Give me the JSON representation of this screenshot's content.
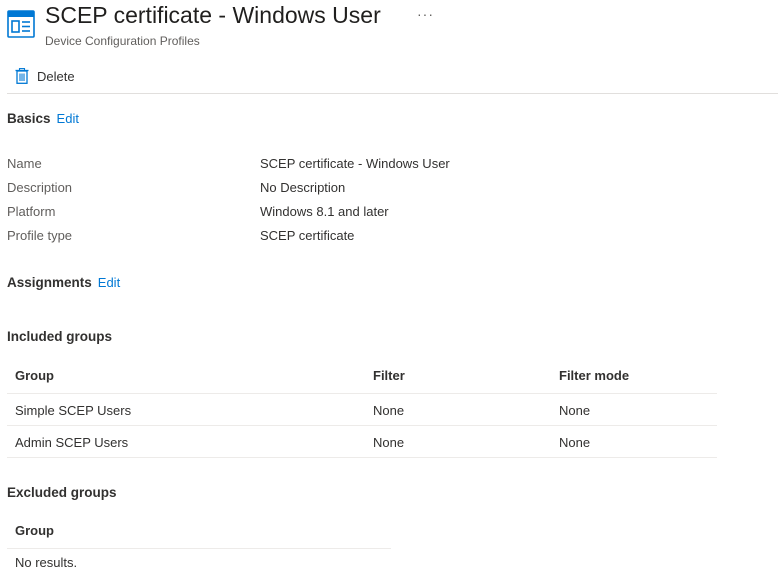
{
  "header": {
    "title": "SCEP certificate - Windows User",
    "more_label": "···",
    "subtitle": "Device Configuration Profiles",
    "icon": "profile-window-icon"
  },
  "toolbar": {
    "delete_label": "Delete",
    "delete_icon": "trash-icon"
  },
  "basics": {
    "title": "Basics",
    "edit_label": "Edit",
    "properties": [
      {
        "label": "Name",
        "value": "SCEP certificate - Windows User"
      },
      {
        "label": "Description",
        "value": "No Description"
      },
      {
        "label": "Platform",
        "value": "Windows 8.1 and later"
      },
      {
        "label": "Profile type",
        "value": "SCEP certificate"
      }
    ]
  },
  "assignments": {
    "title": "Assignments",
    "edit_label": "Edit",
    "included": {
      "title": "Included groups",
      "columns": [
        "Group",
        "Filter",
        "Filter mode"
      ],
      "rows": [
        [
          "Simple SCEP Users",
          "None",
          "None"
        ],
        [
          "Admin SCEP Users",
          "None",
          "None"
        ]
      ]
    },
    "excluded": {
      "title": "Excluded groups",
      "columns": [
        "Group"
      ],
      "empty_text": "No results."
    }
  },
  "colors": {
    "accent": "#0078d4",
    "text": "#323130",
    "muted": "#605e5c",
    "divider": "#e1dfdd"
  }
}
